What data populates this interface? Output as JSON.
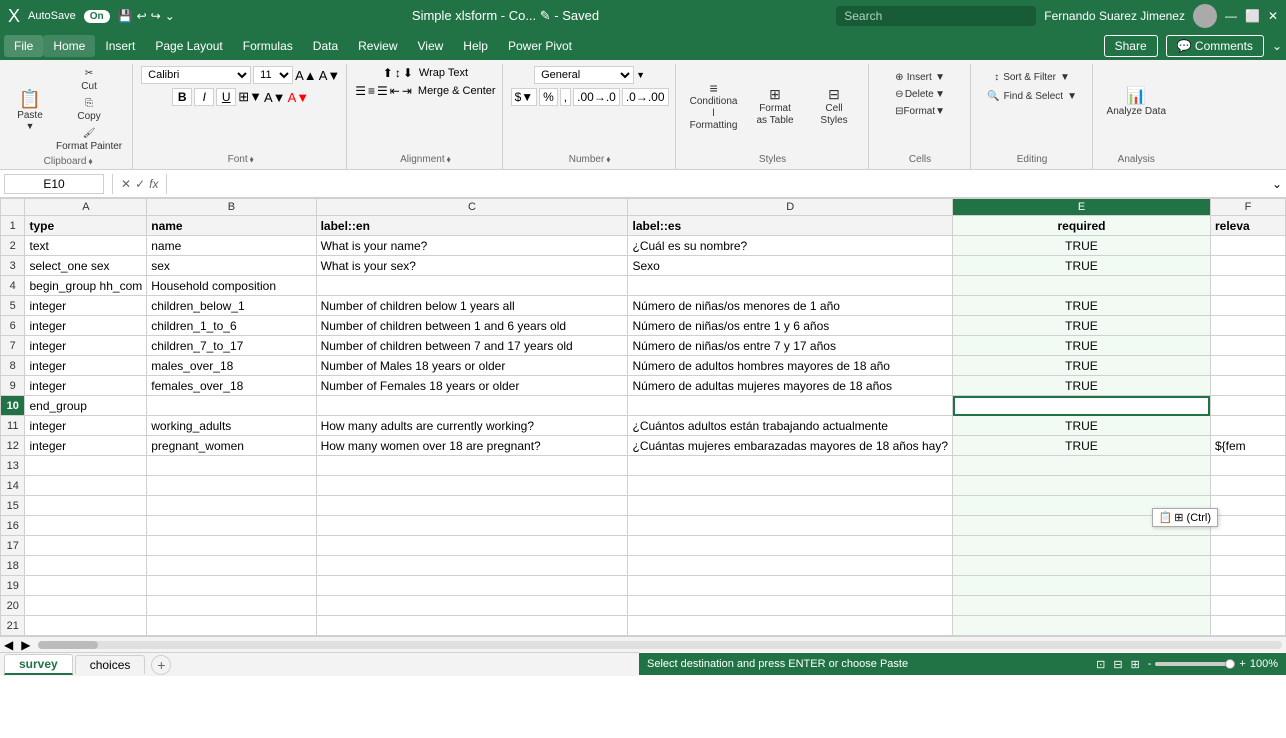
{
  "titleBar": {
    "autosave": "AutoSave",
    "autosave_state": "On",
    "filename": "Simple xlsform - Co... ✎ - Saved",
    "search_placeholder": "Search",
    "user": "Fernando Suarez Jimenez"
  },
  "menuBar": {
    "items": [
      "File",
      "Home",
      "Insert",
      "Page Layout",
      "Formulas",
      "Data",
      "Review",
      "View",
      "Help",
      "Power Pivot"
    ]
  },
  "ribbon": {
    "clipboard_group": "Clipboard",
    "font_group": "Font",
    "alignment_group": "Alignment",
    "number_group": "Number",
    "styles_group": "Styles",
    "cells_group": "Cells",
    "editing_group": "Editing",
    "analysis_group": "Analysis",
    "paste_label": "Paste",
    "cut_label": "Cut",
    "copy_label": "Copy",
    "format_painter_label": "Format Painter",
    "font_name": "Calibri",
    "font_size": "11",
    "bold": "B",
    "italic": "I",
    "underline": "U",
    "wrap_text": "Wrap Text",
    "merge_center": "Merge & Center",
    "number_format": "General",
    "conditional_formatting": "Conditional Formatting",
    "format_as_table": "Format as Table",
    "cell_styles": "Cell Styles",
    "insert": "Insert",
    "delete": "Delete",
    "format": "Format",
    "sort_filter": "Sort & Filter",
    "find_select": "Find & Select",
    "analyze_data": "Analyze Data"
  },
  "formulaBar": {
    "cell_reference": "E10",
    "formula": ""
  },
  "sheet": {
    "columns": [
      "A",
      "B",
      "C",
      "D",
      "E",
      "F"
    ],
    "selected_cell": "E10",
    "selected_col": "E",
    "selected_row": 10,
    "rows": [
      {
        "num": 1,
        "cells": [
          "type",
          "name",
          "label::en",
          "label::es",
          "required",
          "releva"
        ]
      },
      {
        "num": 2,
        "cells": [
          "text",
          "name",
          "What is your name?",
          "¿Cuál es su nombre?",
          "TRUE",
          ""
        ]
      },
      {
        "num": 3,
        "cells": [
          "select_one sex",
          "sex",
          "What is your sex?",
          "Sexo",
          "TRUE",
          ""
        ]
      },
      {
        "num": 4,
        "cells": [
          "begin_group hh_com",
          "Household composition",
          "",
          "",
          "",
          ""
        ]
      },
      {
        "num": 5,
        "cells": [
          "integer",
          "children_below_1",
          "Number of children below 1 years all",
          "Número de niñas/os menores de 1 año",
          "TRUE",
          ""
        ]
      },
      {
        "num": 6,
        "cells": [
          "integer",
          "children_1_to_6",
          "Number of children between 1 and 6 years old",
          "Número de niñas/os entre 1 y 6 años",
          "TRUE",
          ""
        ]
      },
      {
        "num": 7,
        "cells": [
          "integer",
          "children_7_to_17",
          "Number of children between 7 and 17 years old",
          "Número de niñas/os entre 7 y 17 años",
          "TRUE",
          ""
        ]
      },
      {
        "num": 8,
        "cells": [
          "integer",
          "males_over_18",
          "Number of Males 18 years or older",
          "Número de adultos hombres mayores de 18 año",
          "TRUE",
          ""
        ]
      },
      {
        "num": 9,
        "cells": [
          "integer",
          "females_over_18",
          "Number of Females 18 years or older",
          "Número de adultas mujeres mayores de 18 años",
          "TRUE",
          ""
        ]
      },
      {
        "num": 10,
        "cells": [
          "end_group",
          "",
          "",
          "",
          "",
          ""
        ]
      },
      {
        "num": 11,
        "cells": [
          "integer",
          "working_adults",
          "How many adults are currently working?",
          "¿Cuántos adultos están trabajando actualmente",
          "TRUE",
          ""
        ]
      },
      {
        "num": 12,
        "cells": [
          "integer",
          "pregnant_women",
          "How many women over 18 are pregnant?",
          "¿Cuántas mujeres embarazadas mayores de 18 años hay?",
          "TRUE",
          "${fem"
        ]
      },
      {
        "num": 13,
        "cells": [
          "",
          "",
          "",
          "",
          "",
          ""
        ]
      },
      {
        "num": 14,
        "cells": [
          "",
          "",
          "",
          "",
          "",
          ""
        ]
      },
      {
        "num": 15,
        "cells": [
          "",
          "",
          "",
          "",
          "",
          ""
        ]
      },
      {
        "num": 16,
        "cells": [
          "",
          "",
          "",
          "",
          "",
          ""
        ]
      },
      {
        "num": 17,
        "cells": [
          "",
          "",
          "",
          "",
          "",
          ""
        ]
      },
      {
        "num": 18,
        "cells": [
          "",
          "",
          "",
          "",
          "",
          ""
        ]
      },
      {
        "num": 19,
        "cells": [
          "",
          "",
          "",
          "",
          "",
          ""
        ]
      },
      {
        "num": 20,
        "cells": [
          "",
          "",
          "",
          "",
          "",
          ""
        ]
      },
      {
        "num": 21,
        "cells": [
          "",
          "",
          "",
          "",
          "",
          ""
        ]
      }
    ]
  },
  "sheetTabs": {
    "tabs": [
      "survey",
      "choices"
    ],
    "active": "survey"
  },
  "statusBar": {
    "message": "Select destination and press ENTER or choose Paste",
    "zoom": "100%",
    "view_normal": "Normal",
    "view_layout": "Page Layout",
    "view_page_break": "Page Break Preview"
  },
  "pasteTooltip": {
    "label": "⊞ (Ctrl)"
  }
}
